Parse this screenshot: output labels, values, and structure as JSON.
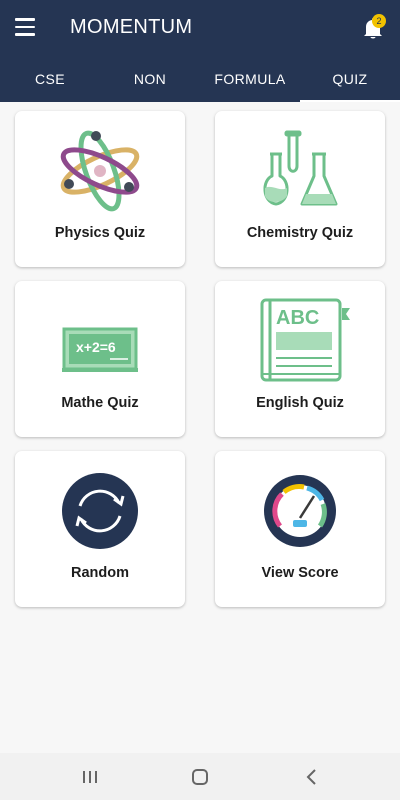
{
  "appbar": {
    "title": "MOMENTUM",
    "notification_count": "2"
  },
  "tabs": [
    {
      "label": "CSE"
    },
    {
      "label": "NON"
    },
    {
      "label": "FORMULA"
    },
    {
      "label": "QUIZ",
      "active": true
    }
  ],
  "cards": [
    {
      "label": "Physics Quiz",
      "icon": "atom-icon"
    },
    {
      "label": "Chemistry Quiz",
      "icon": "flask-icon"
    },
    {
      "label": "Mathe Quiz",
      "icon": "chalkboard-icon"
    },
    {
      "label": "English Quiz",
      "icon": "abc-book-icon"
    },
    {
      "label": "Random",
      "icon": "refresh-icon"
    },
    {
      "label": "View Score",
      "icon": "gauge-icon"
    }
  ],
  "chalkboard_text": "x+2=6",
  "book_text": "ABC",
  "colors": {
    "primary": "#253553",
    "accent_green": "#6dbf8a",
    "badge": "#f2c200"
  }
}
